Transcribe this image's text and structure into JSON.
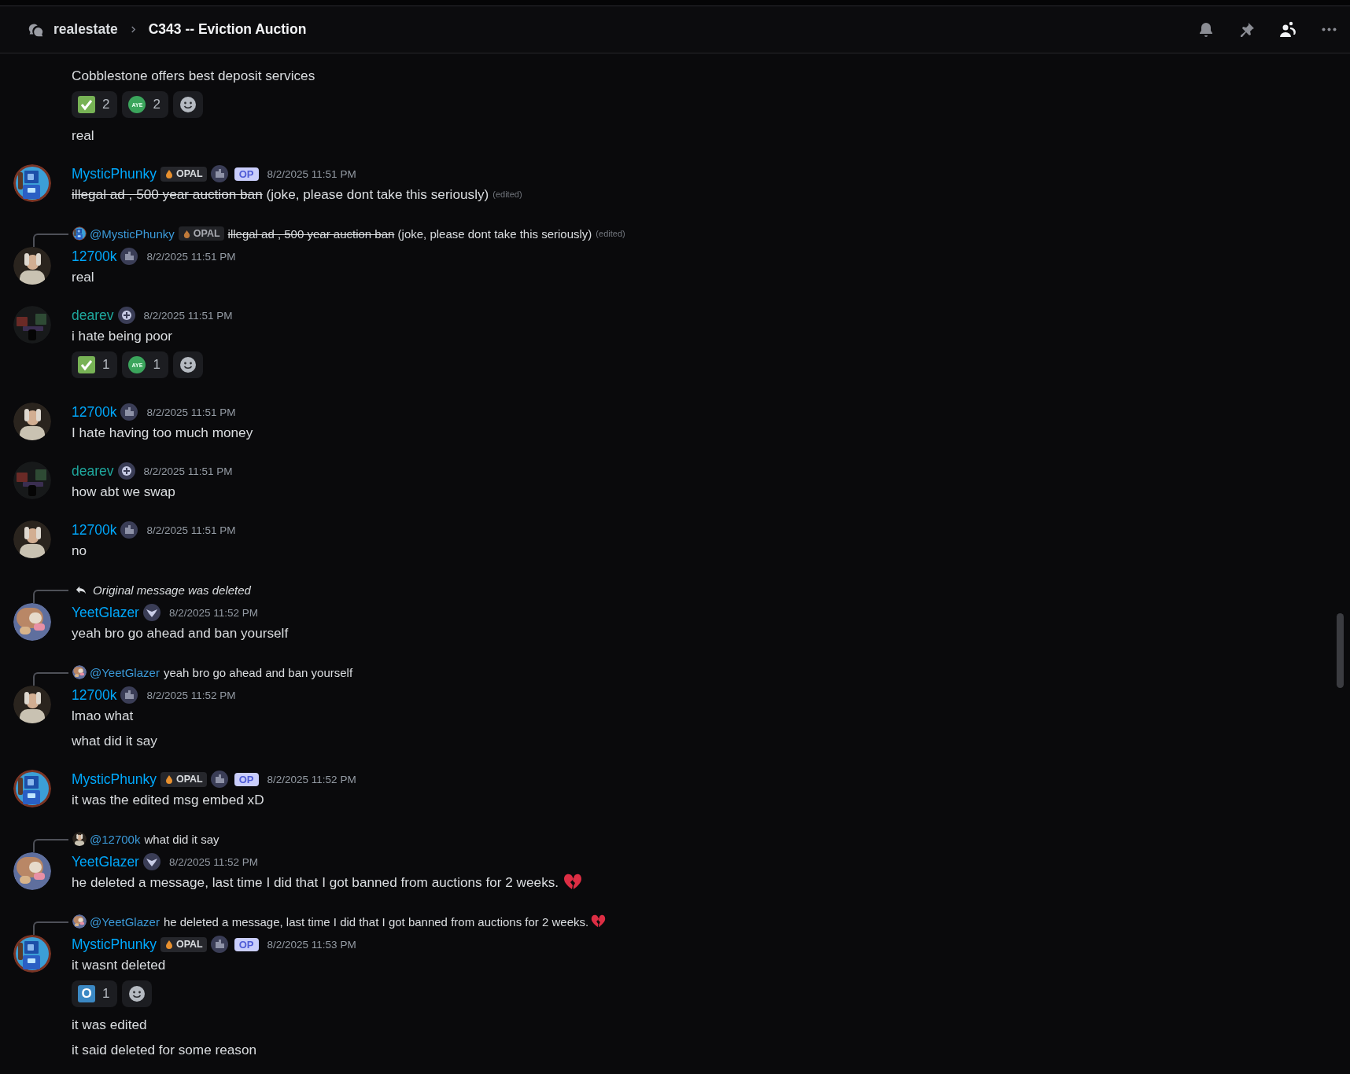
{
  "header": {
    "parent": "realestate",
    "title": "C343 -- Eviction Auction",
    "tools": [
      {
        "kind": "bell",
        "selected": false
      },
      {
        "kind": "pin",
        "selected": false
      },
      {
        "kind": "members",
        "selected": true
      },
      {
        "kind": "more",
        "selected": false
      }
    ]
  },
  "messages": [
    {
      "kind": "continuation",
      "content": [
        {
          "kind": "text",
          "parts": [
            {
              "text": "Cobblestone offers best deposit services",
              "strike": false
            }
          ]
        },
        {
          "kind": "reactions",
          "items": [
            {
              "kind": "check",
              "count": "2"
            },
            {
              "kind": "aye",
              "label": "AYE",
              "count": "2"
            }
          ]
        },
        {
          "kind": "text",
          "parts": [
            {
              "text": "real",
              "strike": false
            }
          ]
        }
      ]
    },
    {
      "kind": "message",
      "author": "MysticPhunky",
      "color": "#00a8fc",
      "badges": [
        {
          "kind": "opal",
          "label": "OPAL"
        },
        {
          "kind": "city_tag"
        },
        {
          "kind": "op",
          "label": "OP"
        }
      ],
      "timestamp": "8/2/2025 11:51 PM",
      "content": [
        {
          "kind": "text",
          "parts": [
            {
              "text": "illegal ad , 500 year auction ban",
              "strike": true
            },
            {
              "text": " (joke, please dont take this seriously)",
              "strike": false
            }
          ],
          "edited": "(edited)"
        }
      ]
    },
    {
      "kind": "message",
      "reply": {
        "kind": "mention",
        "mention": "@MysticPhunky",
        "badges": [
          {
            "kind": "opal",
            "label": "OPAL"
          }
        ],
        "parts": [
          {
            "text": "illegal ad , 500 year auction ban",
            "strike": true
          },
          {
            "text": " (joke, please dont take this seriously)",
            "strike": false
          }
        ],
        "edited": "(edited)"
      },
      "author": "12700k",
      "color": "#00a8fc",
      "badges": [
        {
          "kind": "city_tag"
        }
      ],
      "timestamp": "8/2/2025 11:51 PM",
      "content": [
        {
          "kind": "text",
          "parts": [
            {
              "text": "real",
              "strike": false
            }
          ]
        }
      ]
    },
    {
      "kind": "message",
      "author": "dearev",
      "color": "#1fa89e",
      "badges": [
        {
          "kind": "plus_tag"
        }
      ],
      "timestamp": "8/2/2025 11:51 PM",
      "content": [
        {
          "kind": "text",
          "parts": [
            {
              "text": "i hate being poor",
              "strike": false
            }
          ]
        },
        {
          "kind": "reactions",
          "items": [
            {
              "kind": "check",
              "count": "1"
            },
            {
              "kind": "aye",
              "label": "AYE",
              "count": "1"
            }
          ]
        }
      ]
    },
    {
      "kind": "message",
      "author": "12700k",
      "color": "#00a8fc",
      "badges": [
        {
          "kind": "city_tag"
        }
      ],
      "timestamp": "8/2/2025 11:51 PM",
      "content": [
        {
          "kind": "text",
          "parts": [
            {
              "text": "I hate having too much money",
              "strike": false
            }
          ]
        }
      ]
    },
    {
      "kind": "message",
      "author": "dearev",
      "color": "#1fa89e",
      "badges": [
        {
          "kind": "plus_tag"
        }
      ],
      "timestamp": "8/2/2025 11:51 PM",
      "content": [
        {
          "kind": "text",
          "parts": [
            {
              "text": "how abt we swap",
              "strike": false
            }
          ]
        }
      ]
    },
    {
      "kind": "message",
      "author": "12700k",
      "color": "#00a8fc",
      "badges": [
        {
          "kind": "city_tag"
        }
      ],
      "timestamp": "8/2/2025 11:51 PM",
      "content": [
        {
          "kind": "text",
          "parts": [
            {
              "text": "no",
              "strike": false
            }
          ]
        }
      ]
    },
    {
      "kind": "message",
      "reply": {
        "kind": "deleted",
        "text": "Original message was deleted"
      },
      "author": "YeetGlazer",
      "color": "#00a8fc",
      "badges": [
        {
          "kind": "wing_tag"
        }
      ],
      "timestamp": "8/2/2025 11:52 PM",
      "content": [
        {
          "kind": "text",
          "parts": [
            {
              "text": "yeah bro go ahead and ban yourself",
              "strike": false
            }
          ]
        }
      ]
    },
    {
      "kind": "message",
      "reply": {
        "kind": "mention",
        "mention": "@YeetGlazer",
        "parts": [
          {
            "text": "yeah bro go ahead and ban yourself",
            "strike": false
          }
        ]
      },
      "author": "12700k",
      "color": "#00a8fc",
      "badges": [
        {
          "kind": "city_tag"
        }
      ],
      "timestamp": "8/2/2025 11:52 PM",
      "content": [
        {
          "kind": "text",
          "parts": [
            {
              "text": "lmao what",
              "strike": false
            }
          ]
        },
        {
          "kind": "text",
          "parts": [
            {
              "text": "what did it say",
              "strike": false
            }
          ]
        }
      ]
    },
    {
      "kind": "message",
      "author": "MysticPhunky",
      "color": "#00a8fc",
      "badges": [
        {
          "kind": "opal",
          "label": "OPAL"
        },
        {
          "kind": "city_tag"
        },
        {
          "kind": "op",
          "label": "OP"
        }
      ],
      "timestamp": "8/2/2025 11:52 PM",
      "content": [
        {
          "kind": "text",
          "parts": [
            {
              "text": "it was the edited msg embed xD",
              "strike": false
            }
          ]
        }
      ]
    },
    {
      "kind": "message",
      "reply": {
        "kind": "mention",
        "mention": "@12700k",
        "parts": [
          {
            "text": "what did it say",
            "strike": false
          }
        ]
      },
      "author": "YeetGlazer",
      "color": "#00a8fc",
      "badges": [
        {
          "kind": "wing_tag"
        }
      ],
      "timestamp": "8/2/2025 11:52 PM",
      "content": [
        {
          "kind": "text",
          "parts": [
            {
              "text": "he deleted a message, last time I did that I got banned from auctions for 2 weeks.",
              "strike": false
            }
          ],
          "broken_heart": true
        }
      ]
    },
    {
      "kind": "message",
      "reply": {
        "kind": "mention",
        "mention": "@YeetGlazer",
        "parts": [
          {
            "text": "he deleted a message, last time I did that I got banned from auctions for 2 weeks.",
            "strike": false
          }
        ],
        "broken_heart": true
      },
      "author": "MysticPhunky",
      "color": "#00a8fc",
      "badges": [
        {
          "kind": "opal",
          "label": "OPAL"
        },
        {
          "kind": "city_tag"
        },
        {
          "kind": "op",
          "label": "OP"
        }
      ],
      "timestamp": "8/2/2025 11:53 PM",
      "content": [
        {
          "kind": "text",
          "parts": [
            {
              "text": "it wasnt deleted",
              "strike": false
            }
          ]
        },
        {
          "kind": "reactions",
          "items": [
            {
              "kind": "letter",
              "label": "O",
              "count": "1"
            }
          ]
        },
        {
          "kind": "text",
          "parts": [
            {
              "text": "it was edited",
              "strike": false
            }
          ]
        },
        {
          "kind": "text",
          "parts": [
            {
              "text": "it said deleted for some reason",
              "strike": false
            }
          ]
        }
      ]
    }
  ]
}
